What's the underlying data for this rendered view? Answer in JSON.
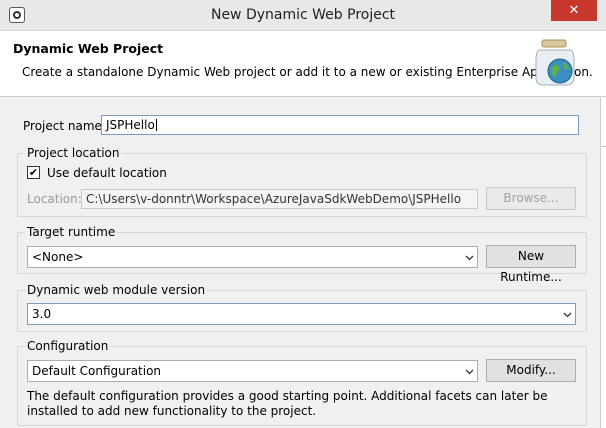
{
  "window": {
    "title": "New Dynamic Web Project",
    "close_label": "✕"
  },
  "header": {
    "title": "Dynamic Web Project",
    "description": "Create a standalone Dynamic Web project or add it to a new or existing Enterprise Application."
  },
  "project_name": {
    "label": "Project name:",
    "value": "JSPHello"
  },
  "project_location": {
    "title": "Project location",
    "use_default_label": "Use default location",
    "use_default_checked": "✔",
    "location_label": "Location:",
    "location_value": "C:\\Users\\v-donntr\\Workspace\\AzureJavaSdkWebDemo\\JSPHello",
    "browse_label": "Browse..."
  },
  "target_runtime": {
    "title": "Target runtime",
    "selected": "<None>",
    "new_runtime_label": "New Runtime..."
  },
  "module_version": {
    "title": "Dynamic web module version",
    "selected": "3.0"
  },
  "configuration": {
    "title": "Configuration",
    "selected": "Default Configuration",
    "modify_label": "Modify...",
    "description": "The default configuration provides a good starting point. Additional facets can later be installed to add new functionality to the project."
  }
}
